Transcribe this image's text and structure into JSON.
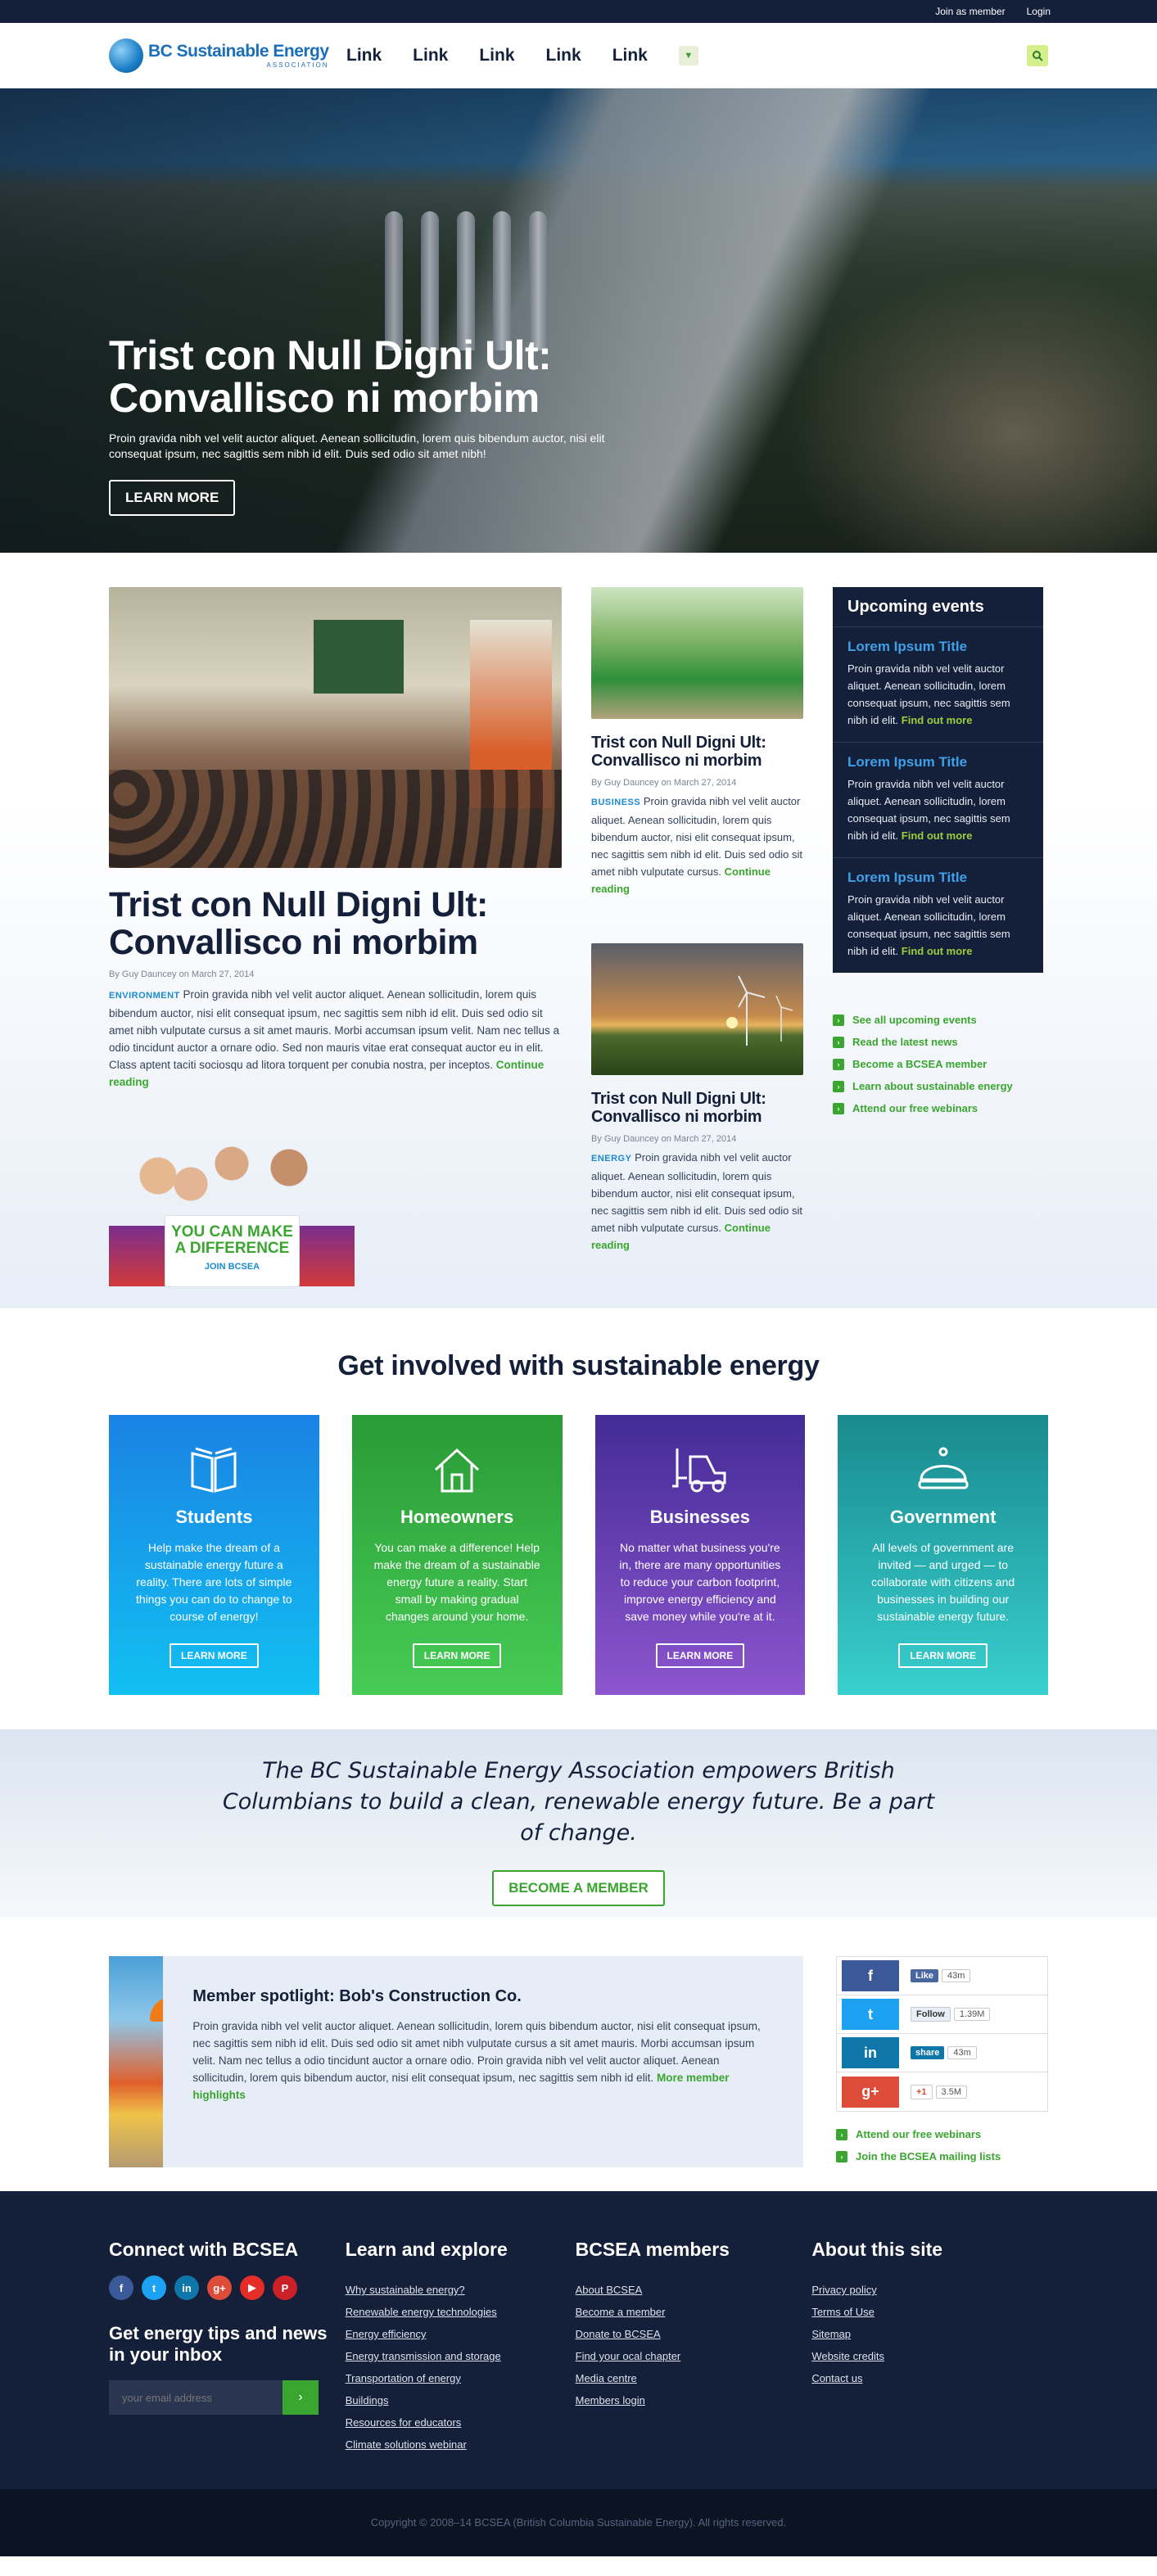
{
  "topbar": {
    "join": "Join as member",
    "login": "Login"
  },
  "header": {
    "logo_main": "BC Sustainable Energy",
    "logo_sub": "ASSOCIATION",
    "nav": [
      "Link",
      "Link",
      "Link",
      "Link",
      "Link"
    ],
    "more_icon": "chevron-down-icon",
    "search_icon": "search-icon"
  },
  "hero": {
    "title": "Trist con Null Digni Ult: Convallisco ni morbim",
    "text": "Proin gravida nibh vel velit auctor aliquet. Aenean sollicitudin, lorem quis bibendum auctor, nisi elit consequat ipsum, nec sagittis sem nibh id elit. Duis sed odio sit amet nibh!",
    "button": "LEARN MORE"
  },
  "feature": {
    "title": "Trist con Null Digni Ult: Convallisco ni morbim",
    "by": "By Guy Dauncey",
    "on": "on",
    "date": "March 27, 2014",
    "category": "ENVIRONMENT",
    "body": "Proin gravida nibh vel velit auctor aliquet. Aenean sollicitudin, lorem quis bibendum auctor, nisi elit consequat ipsum, nec sagittis sem nibh id elit. Duis sed odio sit amet nibh vulputate cursus a sit amet mauris. Morbi accumsan ipsum velit. Nam nec tellus a odio tincidunt auctor a ornare odio. Sed non  mauris vitae erat consequat auctor eu in elit. Class aptent taciti sociosqu ad litora torquent per conubia nostra, per inceptos.",
    "more": "Continue reading",
    "promo_line1": "YOU CAN MAKE A DIFFERENCE",
    "promo_line2": "JOIN BCSEA"
  },
  "articles": [
    {
      "title": "Trist con Null Digni Ult: Convallisco ni morbim",
      "by": "By Guy Dauncey",
      "on": "on",
      "date": "March 27, 2014",
      "category": "BUSINESS",
      "body": "Proin gravida nibh vel velit auctor aliquet. Aenean sollicitudin, lorem quis bibendum auctor, nisi elit consequat ipsum, nec sagittis sem nibh id elit. Duis sed odio sit amet nibh vulputate cursus.",
      "more": "Continue reading"
    },
    {
      "title": "Trist con Null Digni Ult: Convallisco ni morbim",
      "by": "By Guy Dauncey",
      "on": "on",
      "date": "March 27, 2014",
      "category": "ENERGY",
      "body": "Proin gravida nibh vel velit auctor aliquet. Aenean sollicitudin, lorem quis bibendum auctor, nisi elit consequat ipsum, nec sagittis sem nibh id elit. Duis sed odio sit amet nibh vulputate cursus.",
      "more": "Continue reading"
    }
  ],
  "events": {
    "title": "Upcoming events",
    "items": [
      {
        "title": "Lorem Ipsum Title",
        "body": "Proin gravida nibh vel velit auctor aliquet. Aenean sollicitudin, lorem consequat ipsum, nec sagittis sem nibh id elit.",
        "link": "Find out more"
      },
      {
        "title": "Lorem Ipsum Title",
        "body": "Proin gravida nibh vel velit auctor aliquet. Aenean sollicitudin, lorem consequat ipsum, nec sagittis sem nibh id elit.",
        "link": "Find out more"
      },
      {
        "title": "Lorem Ipsum Title",
        "body": "Proin gravida nibh vel velit auctor aliquet. Aenean sollicitudin, lorem consequat ipsum, nec sagittis sem nibh id elit.",
        "link": "Find out more"
      }
    ],
    "links": [
      "See all upcoming events",
      "Read the latest news",
      "Become a BCSEA member",
      "Learn about sustainable energy",
      "Attend our free webinars"
    ]
  },
  "involved": {
    "title": "Get involved with sustainable energy",
    "cards": [
      {
        "title": "Students",
        "body": "Help make the dream of a sustainable energy future a reality. There are lots of simple things you can do to change to course of energy!",
        "button": "LEARN MORE",
        "icon": "book-icon"
      },
      {
        "title": "Homeowners",
        "body": "You can make a difference! Help make the dream of a sustainable energy future a reality. Start small by making gradual changes around your home.",
        "button": "LEARN MORE",
        "icon": "house-icon"
      },
      {
        "title": "Businesses",
        "body": "No matter what business you're in, there are many opportunities to reduce your carbon footprint, improve energy efficiency and save money while you're at it.",
        "button": "LEARN MORE",
        "icon": "forklift-icon"
      },
      {
        "title": "Government",
        "body": "All levels of government are invited — and urged — to collaborate with citizens and businesses in building our sustainable energy future.",
        "button": "LEARN MORE",
        "icon": "crown-icon"
      }
    ]
  },
  "mission": {
    "text": "The BC Sustainable Energy Association empowers British Columbians to build a clean, renewable energy future. Be a part of change.",
    "button": "BECOME A MEMBER"
  },
  "spotlight": {
    "title": "Member spotlight: Bob's Construction Co.",
    "body": "Proin gravida nibh vel velit auctor aliquet. Aenean sollicitudin, lorem quis bibendum auctor, nisi elit consequat ipsum, nec sagittis sem nibh id elit. Duis sed odio sit amet nibh vulputate cursus a sit amet mauris. Morbi accumsan ipsum velit. Nam nec tellus a odio tincidunt auctor a ornare odio. Proin gravida nibh vel velit auctor aliquet. Aenean sollicitudin, lorem quis bibendum auctor, nisi elit consequat ipsum, nec sagittis sem nibh id elit.",
    "more": "More member highlights"
  },
  "social": {
    "rows": [
      {
        "glyph": "f",
        "button": "Like",
        "count": "43m",
        "color": "#3b5998"
      },
      {
        "glyph": "t",
        "button": "Follow",
        "count": "1.39M",
        "color": "#1da1f2"
      },
      {
        "glyph": "in",
        "button": "share",
        "count": "43m",
        "color": "#0e76a8"
      },
      {
        "glyph": "g+",
        "button": "+1",
        "count": "3.5M",
        "color": "#dd4b39"
      }
    ],
    "links": [
      "Attend our free webinars",
      "Join the BCSEA mailing lists"
    ]
  },
  "footer": {
    "connect_title": "Connect with BCSEA",
    "socials": [
      {
        "glyph": "f",
        "color": "#3b5998"
      },
      {
        "glyph": "t",
        "color": "#1da1f2"
      },
      {
        "glyph": "in",
        "color": "#0e76a8"
      },
      {
        "glyph": "g+",
        "color": "#dd4b39"
      },
      {
        "glyph": "▶",
        "color": "#e52d27"
      },
      {
        "glyph": "P",
        "color": "#cb2027"
      }
    ],
    "newsletter_title": "Get energy tips and news in your inbox",
    "email_placeholder": "your email address",
    "learn_title": "Learn and explore",
    "learn_links": [
      "Why sustainable energy?",
      "Renewable energy technologies",
      "Energy efficiency",
      "Energy transmission and storage",
      "Transportation of energy",
      "Buildings",
      "Resources for educators",
      "Climate solutions webinar"
    ],
    "members_title": "BCSEA members",
    "members_links": [
      "About BCSEA",
      "Become a member",
      "Donate to BCSEA",
      "Find your ocal chapter",
      "Media centre",
      "Members login"
    ],
    "about_title": "About this site",
    "about_links": [
      "Privacy policy",
      "Terms of Use",
      "Sitemap",
      "Website credits",
      "Contact us"
    ],
    "copyright": "Copyright © 2008–14 BCSEA (British Columbia Sustainable Energy). All rights reserved."
  }
}
